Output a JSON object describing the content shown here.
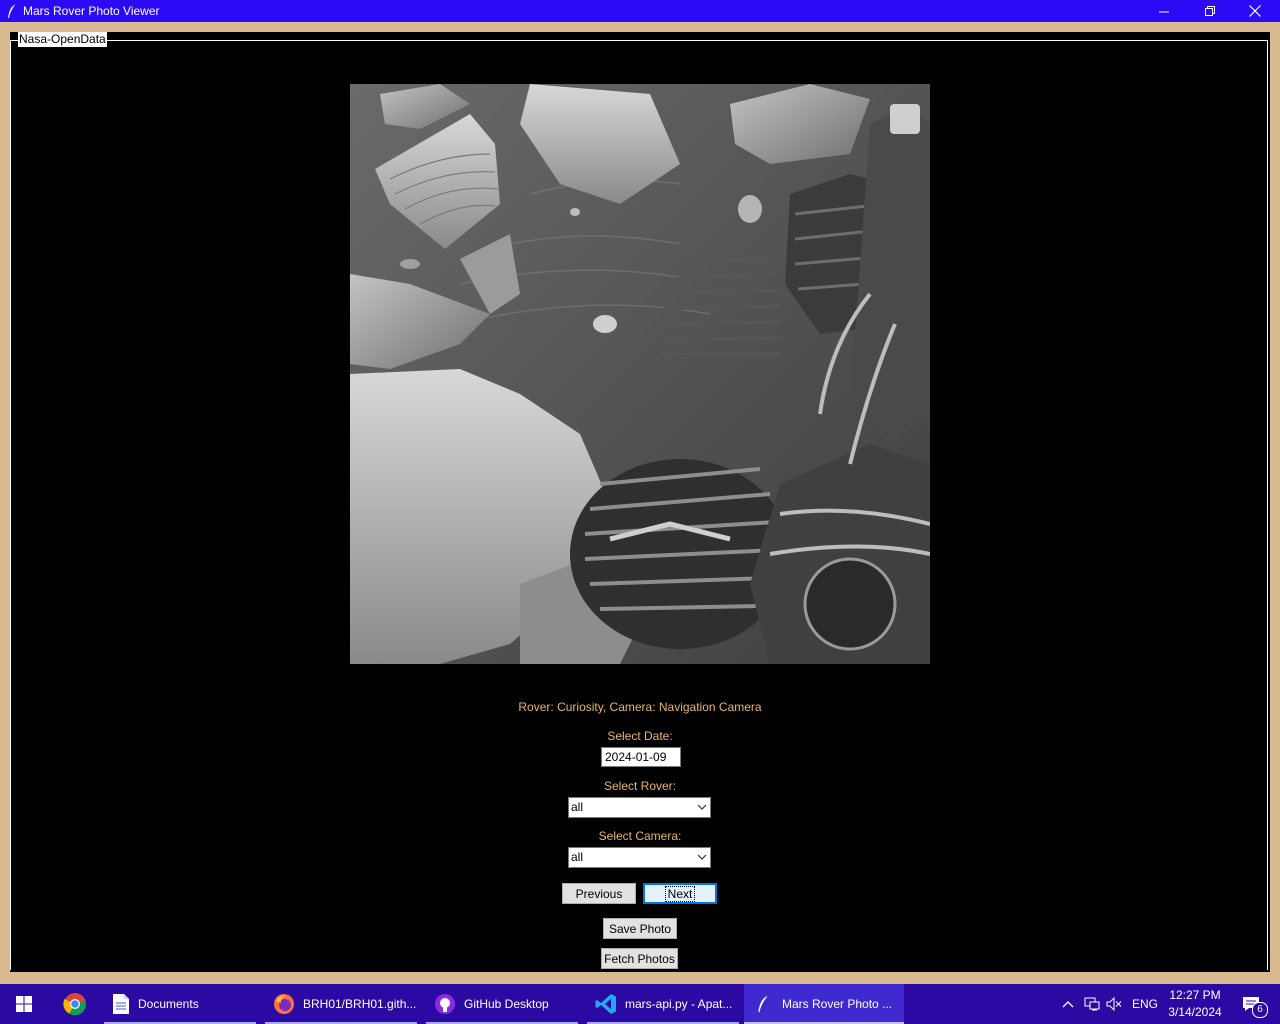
{
  "window": {
    "title": "Mars Rover Photo Viewer"
  },
  "groupbox": {
    "label": "Nasa-OpenData"
  },
  "photo": {
    "rover": "Curiosity",
    "camera": "Navigation Camera",
    "caption": "Rover: Curiosity, Camera: Navigation Camera"
  },
  "date_field": {
    "label": "Select Date:",
    "value": "2024-01-09"
  },
  "rover_select": {
    "label": "Select Rover:",
    "value": "all"
  },
  "camera_select": {
    "label": "Select Camera:",
    "value": "all"
  },
  "buttons": {
    "previous": "Previous",
    "next": "Next",
    "save": "Save Photo",
    "fetch": "Fetch Photos"
  },
  "taskbar": {
    "items": [
      {
        "label": "Documents",
        "icon": "file-explorer-icon"
      },
      {
        "label": "BRH01/BRH01.gith...",
        "icon": "firefox-icon"
      },
      {
        "label": "GitHub Desktop",
        "icon": "github-icon"
      },
      {
        "label": "mars-api.py - Apat...",
        "icon": "vscode-icon"
      },
      {
        "label": "Mars Rover Photo ...",
        "icon": "feather-icon"
      }
    ],
    "tray": {
      "language": "ENG",
      "time": "12:27 PM",
      "date": "3/14/2024",
      "notification_count": "6"
    }
  },
  "colors": {
    "title_bar": "#2d0af5",
    "taskbar": "#2b0aa3",
    "frame_border": "#d9b98f",
    "caption_text": "#e8b56a",
    "background": "#000000"
  }
}
